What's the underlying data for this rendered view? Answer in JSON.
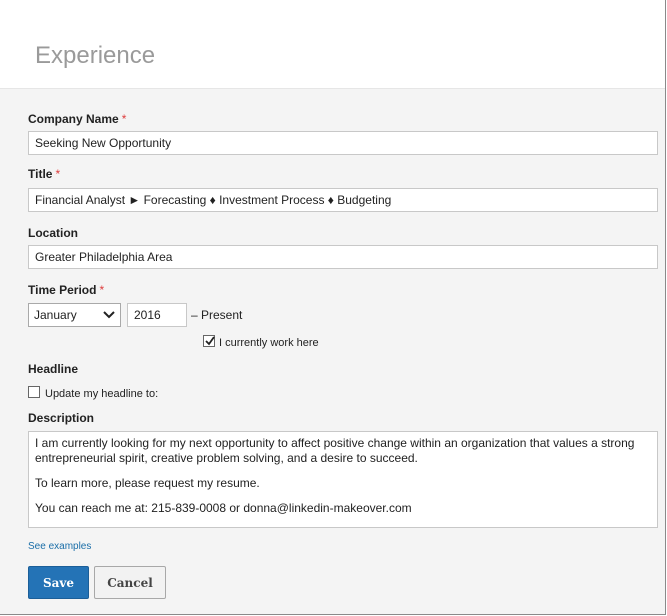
{
  "section": {
    "title": "Experience"
  },
  "company": {
    "label": "Company Name",
    "required": "*",
    "value": "Seeking New Opportunity"
  },
  "title_field": {
    "label": "Title",
    "required": "*",
    "value": "Financial Analyst ► Forecasting ♦ Investment Process ♦ Budgeting"
  },
  "location": {
    "label": "Location",
    "value": "Greater Philadelphia Area"
  },
  "time_period": {
    "label": "Time Period",
    "required": "*",
    "month": "January",
    "year": "2016",
    "present": "– Present",
    "current_label": "I currently work here",
    "current_checked": true
  },
  "headline": {
    "label": "Headline",
    "update_label": "Update my headline to:",
    "update_checked": false
  },
  "description": {
    "label": "Description",
    "paragraphs": [
      "I am currently looking for my next opportunity to affect positive change within an organization that values a strong entrepreneurial spirit, creative problem solving, and a desire to succeed.",
      "To learn more, please request my resume.",
      "You can reach me at: 215-839-0008 or donna@linkedin-makeover.com"
    ]
  },
  "links": {
    "see_examples": "See examples"
  },
  "buttons": {
    "save": "Save",
    "cancel": "Cancel"
  },
  "colors": {
    "accent": "#2473b6",
    "required": "#dd3b3b",
    "link": "#1a6ea8"
  }
}
